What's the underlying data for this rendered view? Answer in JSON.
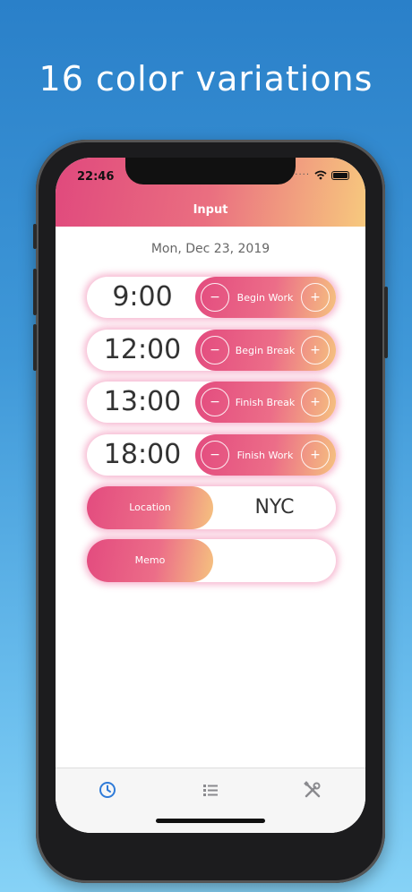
{
  "promo": {
    "headline": "16 color variations"
  },
  "status_bar": {
    "time": "22:46"
  },
  "nav": {
    "title": "Input"
  },
  "date": "Mon, Dec 23, 2019",
  "entries": [
    {
      "time": "9:00",
      "action": "Begin Work",
      "minus": "−",
      "plus": "+"
    },
    {
      "time": "12:00",
      "action": "Begin Break",
      "minus": "−",
      "plus": "+"
    },
    {
      "time": "13:00",
      "action": "Finish Break",
      "minus": "−",
      "plus": "+"
    },
    {
      "time": "18:00",
      "action": "Finish Work",
      "minus": "−",
      "plus": "+"
    }
  ],
  "location": {
    "label": "Location",
    "value": "NYC"
  },
  "memo": {
    "label": "Memo",
    "value": ""
  },
  "tabbar": {
    "tabs": [
      {
        "icon": "clock-icon",
        "active": true
      },
      {
        "icon": "list-icon",
        "active": false
      },
      {
        "icon": "tools-icon",
        "active": false
      }
    ],
    "active_color": "#2f7bd8",
    "inactive_color": "#8a8a8e"
  },
  "colors": {
    "gradient_start": "#e34b7f",
    "gradient_end": "#f5c27f",
    "glow": "#ec6096"
  }
}
